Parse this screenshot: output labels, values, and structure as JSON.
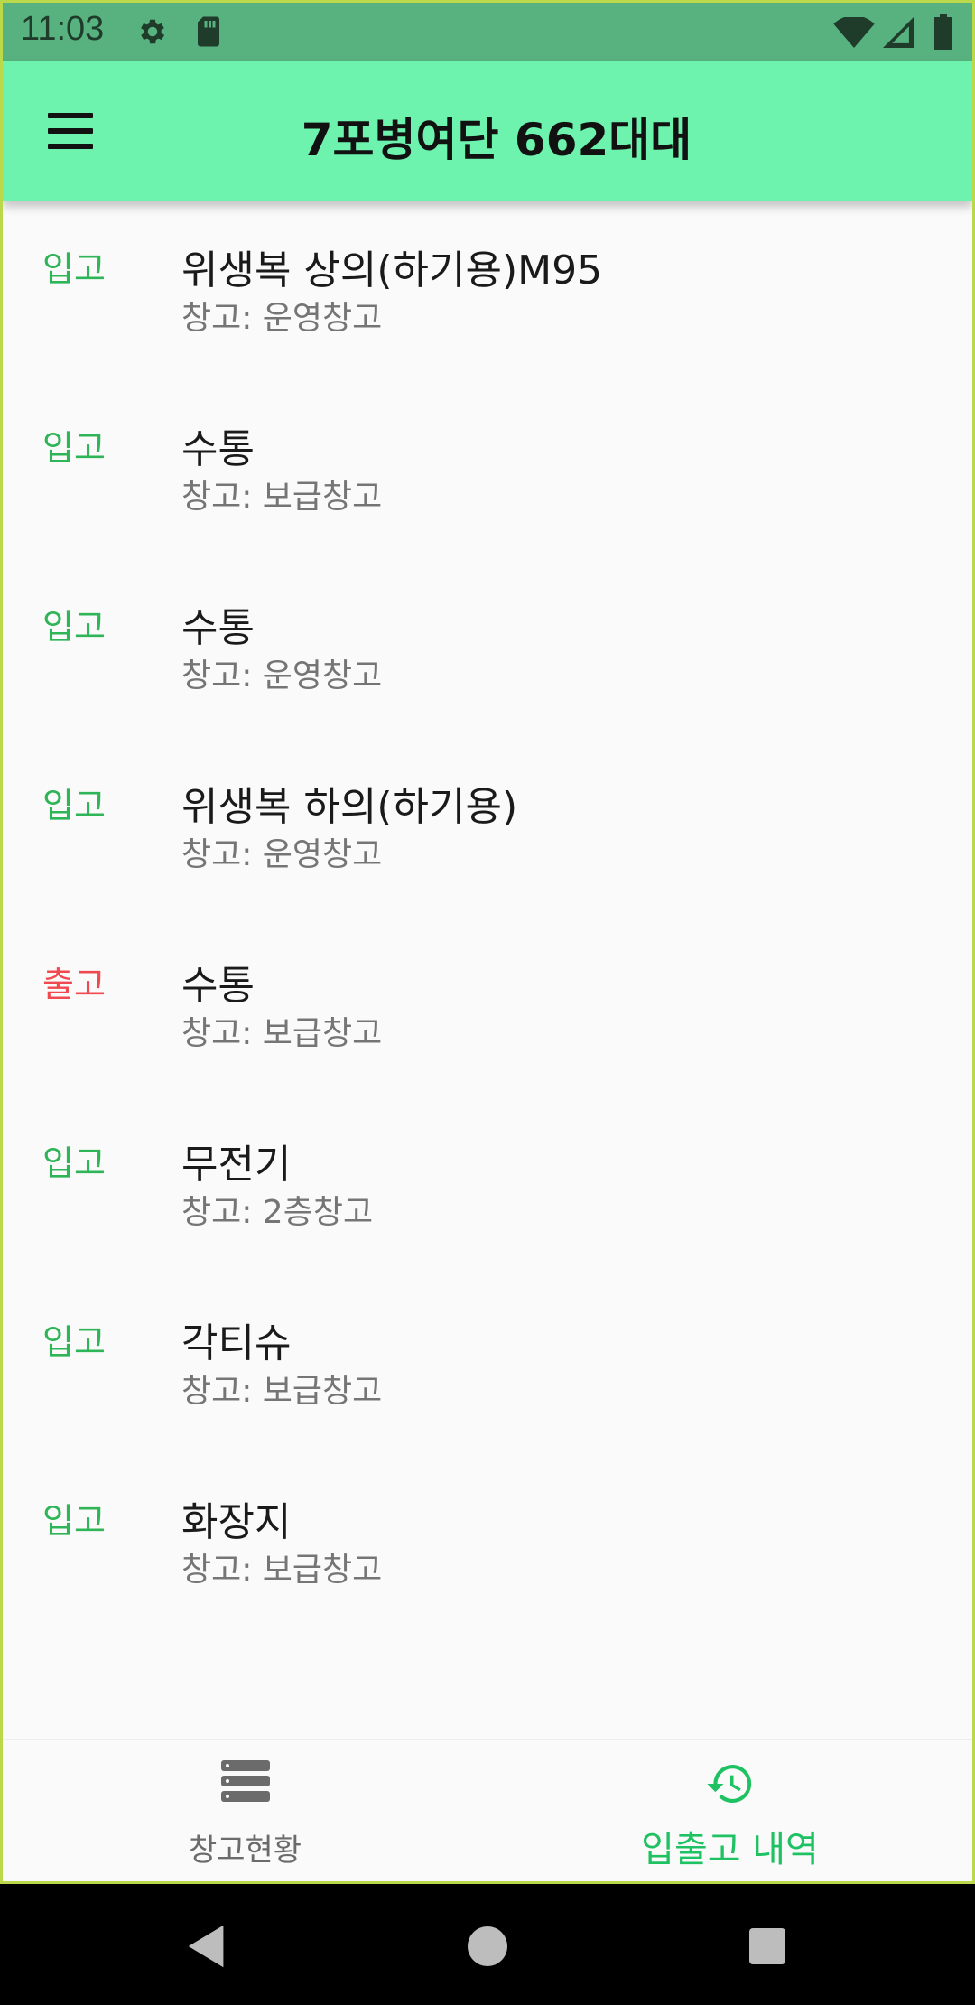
{
  "status_bar": {
    "time": "11:03",
    "icons": [
      "gear-icon",
      "sd-card-icon",
      "wifi-icon",
      "signal-icon",
      "battery-icon"
    ]
  },
  "app_bar": {
    "title": "7포병여단 662대대",
    "menu_icon": "hamburger-menu-icon",
    "background": "#6df3ae"
  },
  "transactions": [
    {
      "type": "입고",
      "kind": "in",
      "item": "위생복 상의(하기용)M95",
      "warehouse": "창고: 운영창고"
    },
    {
      "type": "입고",
      "kind": "in",
      "item": "수통",
      "warehouse": "창고: 보급창고"
    },
    {
      "type": "입고",
      "kind": "in",
      "item": "수통",
      "warehouse": "창고: 운영창고"
    },
    {
      "type": "입고",
      "kind": "in",
      "item": "위생복 하의(하기용)",
      "warehouse": "창고: 운영창고"
    },
    {
      "type": "출고",
      "kind": "out",
      "item": "수통",
      "warehouse": "창고: 보급창고"
    },
    {
      "type": "입고",
      "kind": "in",
      "item": "무전기",
      "warehouse": "창고: 2층창고"
    },
    {
      "type": "입고",
      "kind": "in",
      "item": "각티슈",
      "warehouse": "창고: 보급창고"
    },
    {
      "type": "입고",
      "kind": "in",
      "item": "화장지",
      "warehouse": "창고: 보급창고"
    }
  ],
  "bottom_nav": {
    "items": [
      {
        "label": "창고현황",
        "icon": "stacked-list-icon",
        "active": false
      },
      {
        "label": "입출고 내역",
        "icon": "history-icon",
        "active": true
      }
    ]
  },
  "colors": {
    "in": "#2fb457",
    "out": "#f0494f",
    "active_nav": "#1fc262",
    "status_bar": "#58b27f"
  }
}
